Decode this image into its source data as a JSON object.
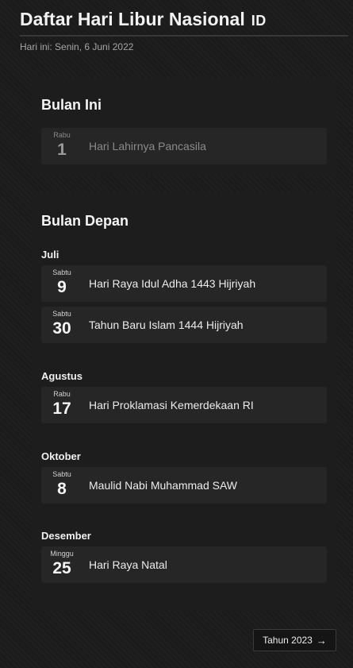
{
  "header": {
    "title": "Daftar Hari Libur Nasional",
    "flag": "ID",
    "today": "Hari ini: Senin, 6 Juni 2022"
  },
  "this_month": {
    "title": "Bulan Ini",
    "items": [
      {
        "day": "Rabu",
        "date": "1",
        "event": "Hari Lahirnya Pancasila"
      }
    ]
  },
  "next_months": {
    "title": "Bulan Depan",
    "groups": [
      {
        "month": "Juli",
        "items": [
          {
            "day": "Sabtu",
            "date": "9",
            "event": "Hari Raya Idul Adha 1443 Hijriyah"
          },
          {
            "day": "Sabtu",
            "date": "30",
            "event": "Tahun Baru Islam 1444 Hijriyah"
          }
        ]
      },
      {
        "month": "Agustus",
        "items": [
          {
            "day": "Rabu",
            "date": "17",
            "event": "Hari Proklamasi Kemerdekaan RI"
          }
        ]
      },
      {
        "month": "Oktober",
        "items": [
          {
            "day": "Sabtu",
            "date": "8",
            "event": "Maulid Nabi Muhammad SAW"
          }
        ]
      },
      {
        "month": "Desember",
        "items": [
          {
            "day": "Minggu",
            "date": "25",
            "event": "Hari Raya Natal"
          }
        ]
      }
    ]
  },
  "footer": {
    "next_year_label": "Tahun 2023",
    "next_year_icon": "arrow-right-icon"
  }
}
